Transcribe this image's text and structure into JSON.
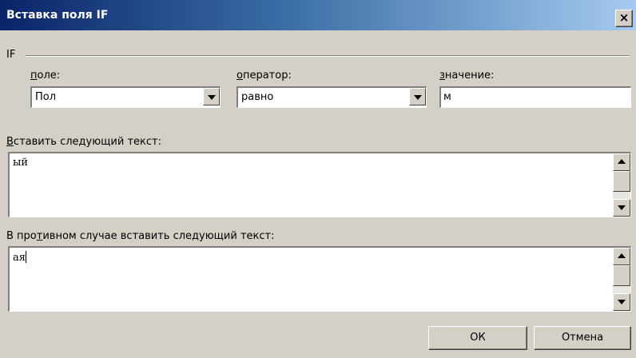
{
  "dialog": {
    "title": "Вставка поля IF",
    "close_glyph": "×"
  },
  "group": {
    "label": "IF"
  },
  "field": {
    "label_first": "п",
    "label_rest": "оле:",
    "value": "Пол"
  },
  "operator": {
    "label_first": "о",
    "label_rest": "ператор:",
    "value": "равно"
  },
  "compare_value": {
    "label_first": "з",
    "label_rest": "начение:",
    "value": "м"
  },
  "insert_text": {
    "label_first": "В",
    "label_rest": "ставить следующий текст:",
    "value": "ый"
  },
  "else_text": {
    "label_before": "В про",
    "label_accel": "т",
    "label_after": "ивном случае вставить следующий текст:",
    "value": "ая"
  },
  "buttons": {
    "ok": "ОК",
    "cancel": "Отмена"
  },
  "icons": {
    "close": "close-icon",
    "dropdown": "chevron-down-icon",
    "scroll_up": "arrow-up-icon",
    "scroll_down": "arrow-down-icon"
  }
}
